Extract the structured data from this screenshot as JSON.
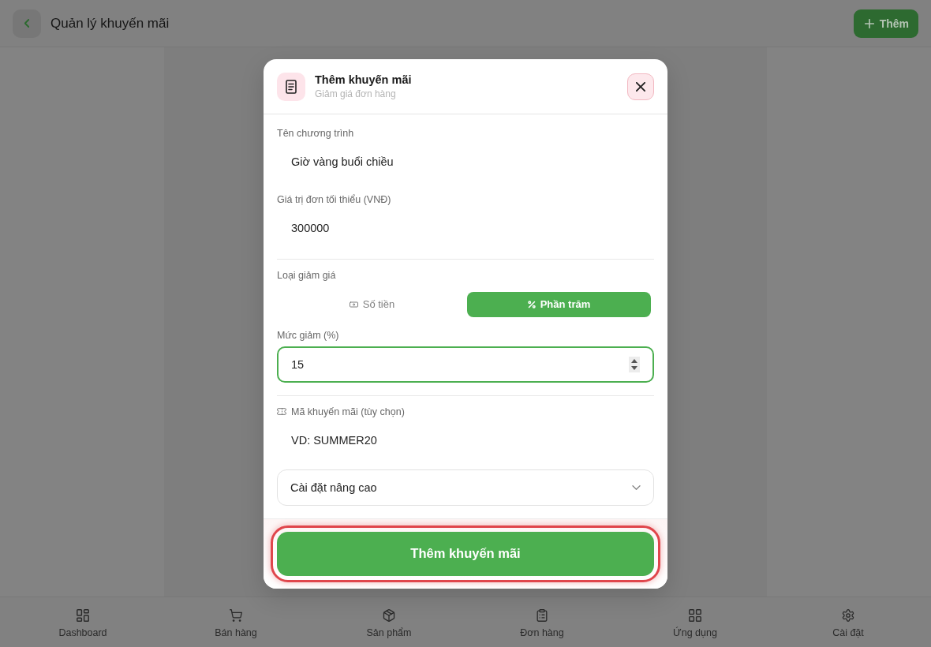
{
  "header": {
    "title": "Quản lý khuyến mãi",
    "add_label": "Thêm"
  },
  "dialog": {
    "title": "Thêm khuyến mãi",
    "subtitle": "Giảm giá đơn hàng",
    "name_field": {
      "label": "Tên chương trình",
      "value": "Giờ vàng buổi chiều"
    },
    "min_order_field": {
      "label": "Giá trị đơn tối thiểu (VNĐ)",
      "value": "300000"
    },
    "discount_type": {
      "label": "Loại giảm giá",
      "options": [
        {
          "label": "Số tiền",
          "selected": false
        },
        {
          "label": "Phần trăm",
          "selected": true
        }
      ]
    },
    "discount_field": {
      "label": "Mức giảm (%)",
      "value": "15",
      "focused": true
    },
    "code_field": {
      "label": "Mã khuyến mãi (tùy chọn)",
      "placeholder": "VD: SUMMER20"
    },
    "advanced": {
      "label": "Cài đặt nâng cao",
      "expanded": false
    },
    "submit": {
      "label": "Thêm khuyến mãi",
      "focused": true
    }
  },
  "bottom_nav": [
    {
      "label": "Dashboard",
      "selected": false
    },
    {
      "label": "Bán hàng",
      "selected": false
    },
    {
      "label": "Sản phẩm",
      "selected": false
    },
    {
      "label": "Đơn hàng",
      "selected": false
    },
    {
      "label": "Ứng dụng",
      "selected": false
    },
    {
      "label": "Cài đặt",
      "selected": false
    }
  ]
}
